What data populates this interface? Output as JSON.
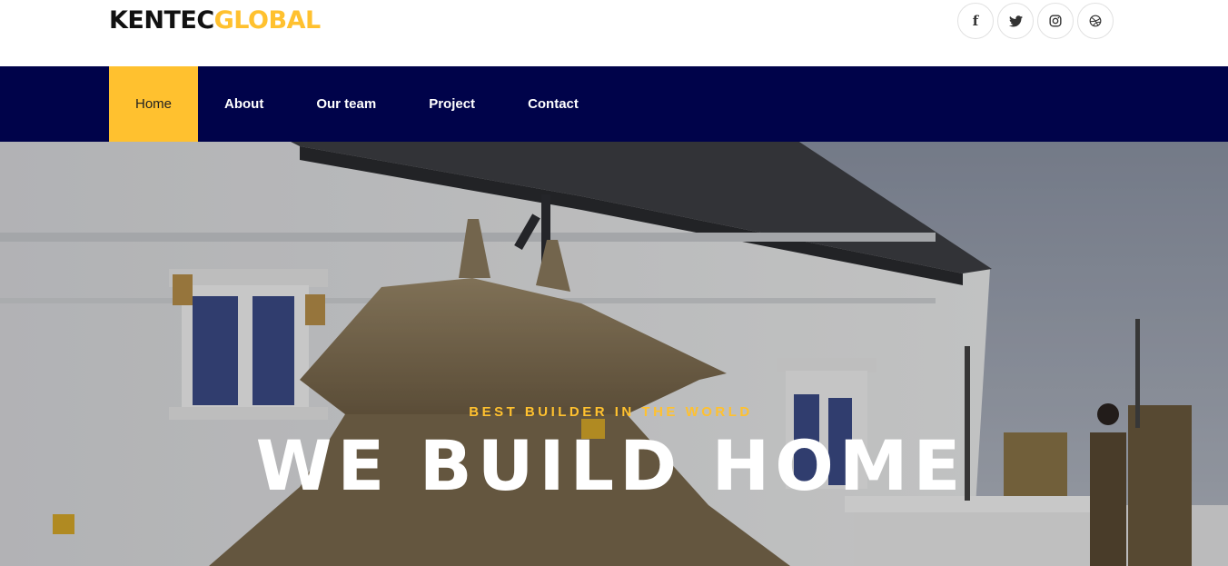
{
  "brand": {
    "part1": "KENTEC",
    "part2": "GLOBAL"
  },
  "socials": [
    {
      "icon": "facebook-icon",
      "glyph": "f"
    },
    {
      "icon": "twitter-icon"
    },
    {
      "icon": "instagram-icon"
    },
    {
      "icon": "dribbble-icon"
    }
  ],
  "nav": {
    "items": [
      {
        "label": "Home",
        "active": true
      },
      {
        "label": "About"
      },
      {
        "label": "Our team"
      },
      {
        "label": "Project"
      },
      {
        "label": "Contact"
      }
    ]
  },
  "hero": {
    "kicker": "BEST BUILDER IN THE WORLD",
    "headline": "WE BUILD HOME"
  },
  "colors": {
    "accent": "#ffc12f",
    "nav_bg": "#00034a"
  }
}
